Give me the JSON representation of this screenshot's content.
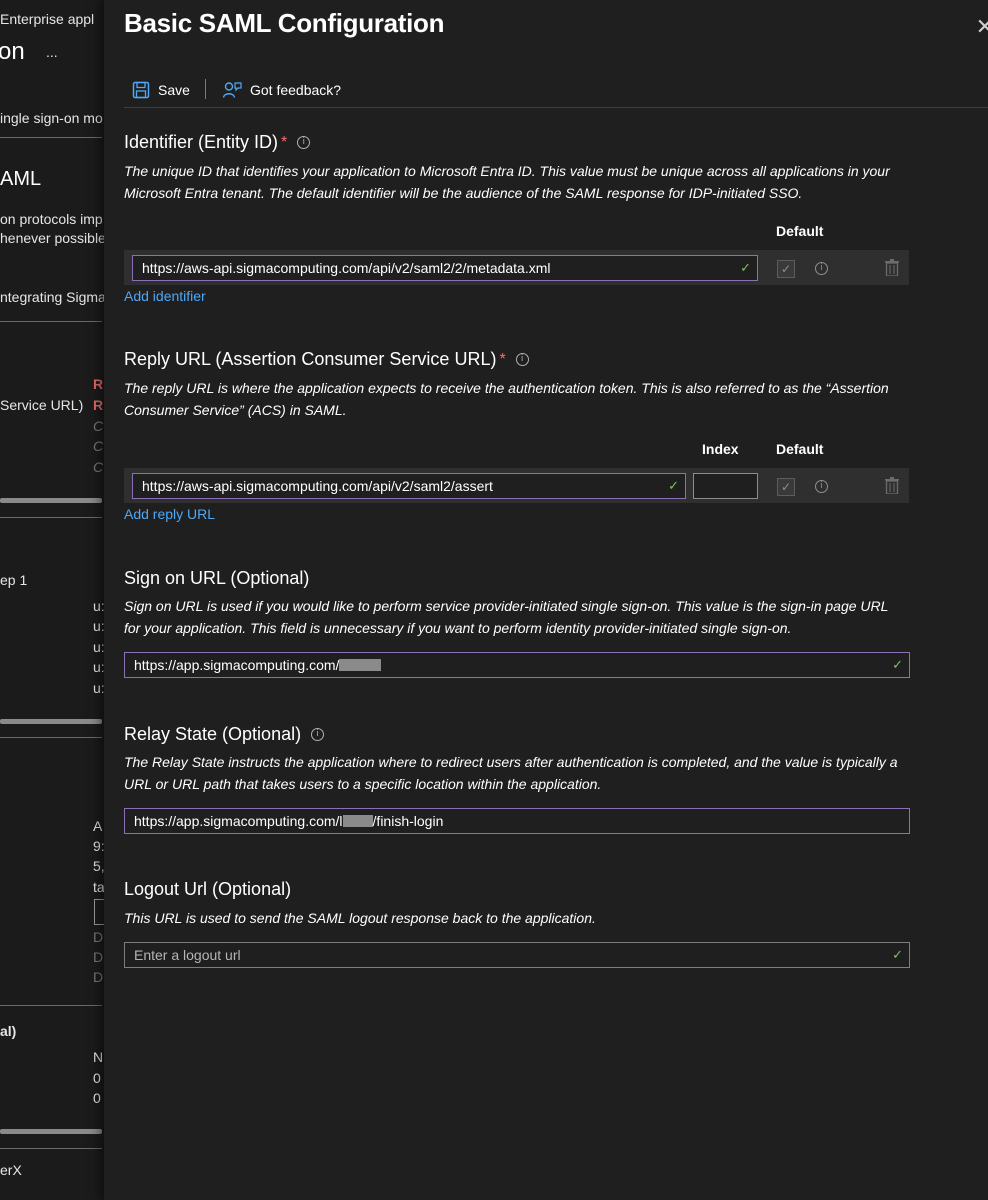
{
  "background": {
    "breadcrumb": "Enterprise appl",
    "page_title_fragment": "on",
    "more_label": "...",
    "intro_fragment": "ingle sign-on mo",
    "saml_heading": "AML",
    "protocols_line1": "on protocols imp",
    "protocols_line2": "henever possible",
    "integrating": "ntegrating Sigma",
    "reply_label": "Service URL)",
    "red1": "R",
    "red2": "R",
    "gray1": "C",
    "gray2": "C",
    "gray3": "C",
    "step_label": "ep 1",
    "u1": "u:",
    "u2": "u:",
    "u3": "u:",
    "u4": "u:",
    "u5": "u:",
    "a1": "A",
    "a2": "9:",
    "a3": "5,",
    "a4": "ta",
    "d1": "D",
    "d2": "D",
    "d3": "D",
    "al_label": "al)",
    "n1": "N",
    "n2": "0",
    "n3": "0",
    "erx": "erX"
  },
  "blade": {
    "title": "Basic SAML Configuration",
    "close_glyph": "✕"
  },
  "toolbar": {
    "save_label": "Save",
    "feedback_label": "Got feedback?"
  },
  "identifier": {
    "title": "Identifier (Entity ID)",
    "required": "*",
    "description": "The unique ID that identifies your application to Microsoft Entra ID. This value must be unique across all applications in your Microsoft Entra tenant. The default identifier will be the audience of the SAML response for IDP-initiated SSO.",
    "default_header": "Default",
    "value": "https://aws-api.sigmacomputing.com/api/v2/saml2/2/metadata.xml",
    "add_label": "Add identifier"
  },
  "reply_url": {
    "title": "Reply URL (Assertion Consumer Service URL)",
    "required": "*",
    "description": "The reply URL is where the application expects to receive the authentication token. This is also referred to as the “Assertion Consumer Service” (ACS) in SAML.",
    "index_header": "Index",
    "default_header": "Default",
    "value": "https://aws-api.sigmacomputing.com/api/v2/saml2/assert",
    "index_value": "",
    "add_label": "Add reply URL"
  },
  "sign_on": {
    "title": "Sign on URL (Optional)",
    "description": "Sign on URL is used if you would like to perform service provider-initiated single sign-on. This value is the sign-in page URL for your application. This field is unnecessary if you want to perform identity provider-initiated single sign-on.",
    "value": "https://app.sigmacomputing.com/"
  },
  "relay_state": {
    "title": "Relay State (Optional)",
    "description": "The Relay State instructs the application where to redirect users after authentication is completed, and the value is typically a URL or URL path that takes users to a specific location within the application.",
    "value_prefix": "https://app.sigmacomputing.com/l",
    "value_suffix": "/finish-login"
  },
  "logout": {
    "title": "Logout Url (Optional)",
    "description": "This URL is used to send the SAML logout response back to the application.",
    "placeholder": "Enter a logout url"
  },
  "icons": {
    "check": "✓",
    "info": "i"
  },
  "colors": {
    "accent_link": "#4fa8f5",
    "valid_check": "#7cc35a",
    "focus_border": "#8d6fb5",
    "required": "#ff6b6b"
  }
}
